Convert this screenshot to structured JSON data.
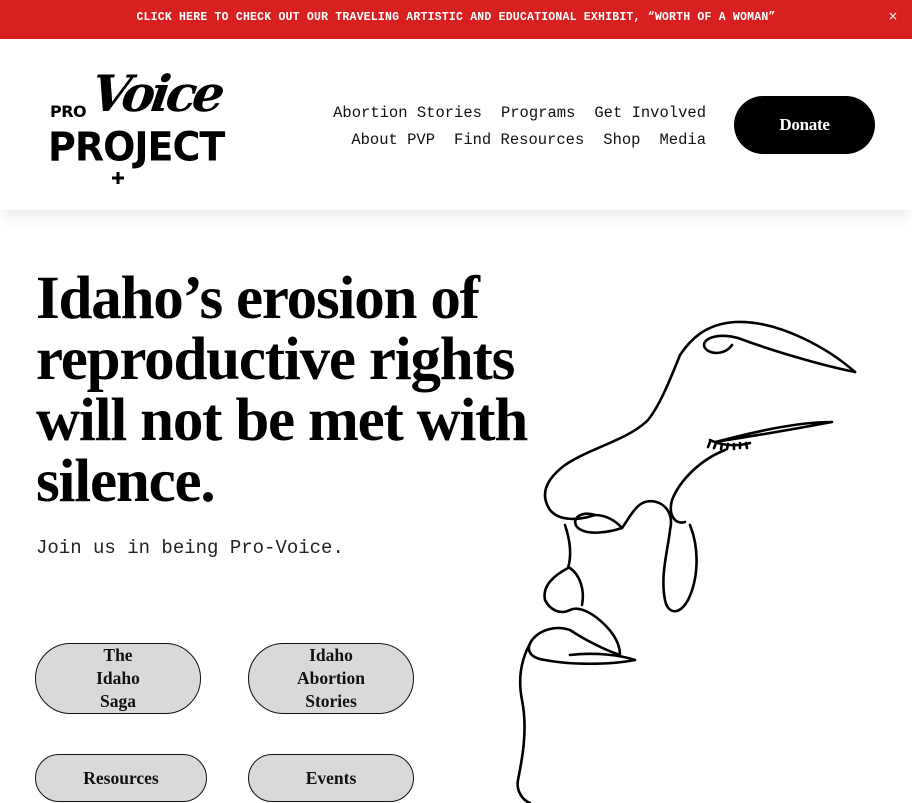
{
  "announcement": {
    "text": "CLICK HERE TO CHECK OUT OUR TRAVELING ARTISTIC AND EDUCATIONAL EXHIBIT, “WORTH OF A WOMAN”",
    "close_glyph": "×",
    "color": "#d82020"
  },
  "logo": {
    "pro": "PRO",
    "voice": "Voice",
    "project": "PROJECT"
  },
  "nav": {
    "row1": [
      "Abortion Stories",
      "Programs",
      "Get Involved"
    ],
    "row2": [
      "About PVP",
      "Find Resources",
      "Shop",
      "Media"
    ]
  },
  "donate_label": "Donate",
  "hero": {
    "title": "Idaho’s erosion of reproductive rights will not be met with silence.",
    "subtitle": "Join us in being Pro-Voice."
  },
  "buttons": {
    "saga": "The Idaho Saga",
    "stories": "Idaho Abortion Stories",
    "resources": "Resources",
    "events": "Events"
  },
  "colors": {
    "accent_red": "#d82020",
    "button_gray": "#d9d9d9"
  }
}
